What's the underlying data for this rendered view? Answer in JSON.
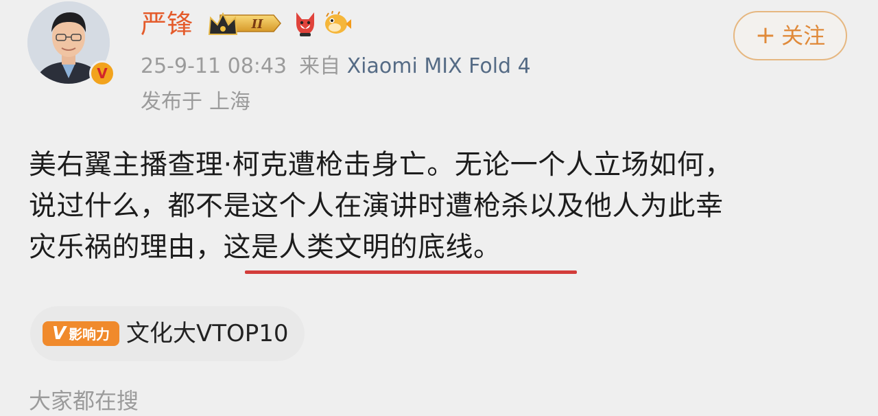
{
  "user": {
    "name": "严锋",
    "verified_mark": "V",
    "level_badge": "II"
  },
  "follow_button": {
    "plus": "+",
    "label": "关注"
  },
  "meta": {
    "timestamp": "25-9-11 08:43",
    "source_prefix": "来自",
    "source_device": "Xiaomi MIX Fold 4",
    "location_prefix": "发布于",
    "location": "上海"
  },
  "post": {
    "line1": "美右翼主播查理·柯克遭枪击身亡。无论一个人立场如何，",
    "line2": "说过什么，都不是这个人在演讲时遭枪杀以及他人为此幸",
    "line3_prefix": "灾乐祸的理由，",
    "line3_highlight": "这是人类文明的底线。"
  },
  "topic": {
    "badge_v": "V",
    "badge_label": "影响力",
    "text": "文化大VTOP10"
  },
  "footer_partial": "大家都在搜",
  "colors": {
    "username": "#e45b2b",
    "accent_orange": "#f08a2c",
    "underline_red": "#d23c3a",
    "muted_gray": "#9b9b9b",
    "device_link": "#556b85"
  },
  "icons": [
    "crown-level-badge-icon",
    "fox-icon",
    "pufferfish-icon",
    "verified-v-icon"
  ]
}
